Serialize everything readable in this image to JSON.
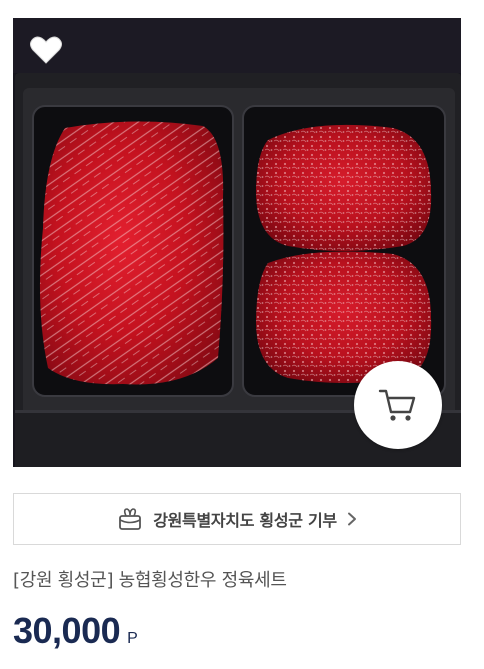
{
  "product": {
    "image_alt": "[강원 횡성군] 농협횡성한우 정육세트",
    "title": "[강원 횡성군] 농협횡성한우 정육세트",
    "price": "30,000",
    "price_unit": "P"
  },
  "donation": {
    "label": "강원특별자치도 횡성군 기부",
    "icon": "gift-box-icon",
    "arrow_icon": "chevron-right-icon"
  },
  "actions": {
    "wish_icon": "heart-icon",
    "cart_icon": "cart-icon"
  },
  "colors": {
    "price": "#1a2a52",
    "title": "#555555",
    "border": "#d9d9d9"
  }
}
